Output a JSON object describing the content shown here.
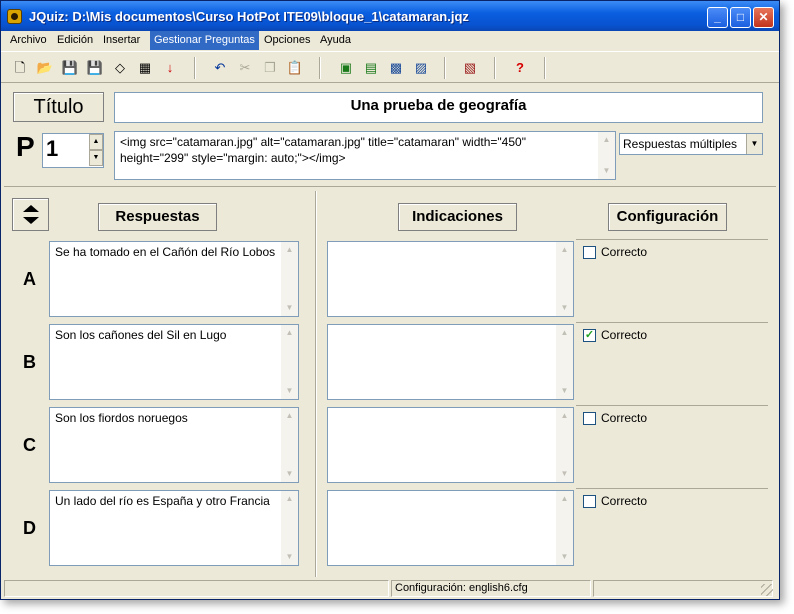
{
  "window": {
    "title": "JQuiz: D:\\Mis documentos\\Curso HotPot ITE09\\bloque_1\\catamaran.jqz",
    "minimize": "_",
    "maximize": "□",
    "close": "✕"
  },
  "menu": [
    "Archivo",
    "Edición",
    "Insertar",
    "Gestionar Preguntas",
    "Opciones",
    "Ayuda"
  ],
  "toolbar": {
    "new": "new-file-icon",
    "open": "open-folder-icon",
    "save": "save-icon",
    "save_as": "save-as-icon",
    "clear": "eraser-icon",
    "web": "web-page-icon",
    "export": "red-arrow-icon",
    "undo": "undo-icon",
    "cut": "cut-icon",
    "copy": "copy-icon",
    "paste": "paste-icon",
    "help": "help-icon"
  },
  "header": {
    "titulo_label": "Título",
    "titulo_value": "Una prueba de geografía",
    "p_label": "P",
    "question_number": "1",
    "question_text": "<img src=\"catamaran.jpg\" alt=\"catamaran.jpg\" title=\"catamaran\" width=\"450\" height=\"299\" style=\"margin: auto;\"></img>",
    "question_type": "Respuestas múltiples"
  },
  "columns": {
    "respuestas": "Respuestas",
    "indicaciones": "Indicaciones",
    "configuracion": "Configuración"
  },
  "answers": [
    {
      "letter": "A",
      "text": "Se ha tomado en el Cañón del Río Lobos",
      "feedback": "",
      "correct_label": "Correcto",
      "correct": false
    },
    {
      "letter": "B",
      "text": "Son los cañones del Sil en Lugo",
      "feedback": "",
      "correct_label": "Correcto",
      "correct": true
    },
    {
      "letter": "C",
      "text": "Son los fiordos noruegos",
      "feedback": "",
      "correct_label": "Correcto",
      "correct": false
    },
    {
      "letter": "D",
      "text": "Un lado del río es España y otro Francia",
      "feedback": "",
      "correct_label": "Correcto",
      "correct": false
    }
  ],
  "status": {
    "config": "Configuración: english6.cfg"
  },
  "colors": {
    "titlebar": "#0a5fe0",
    "menu_highlight": "#316ac5",
    "face": "#ece9d8"
  }
}
